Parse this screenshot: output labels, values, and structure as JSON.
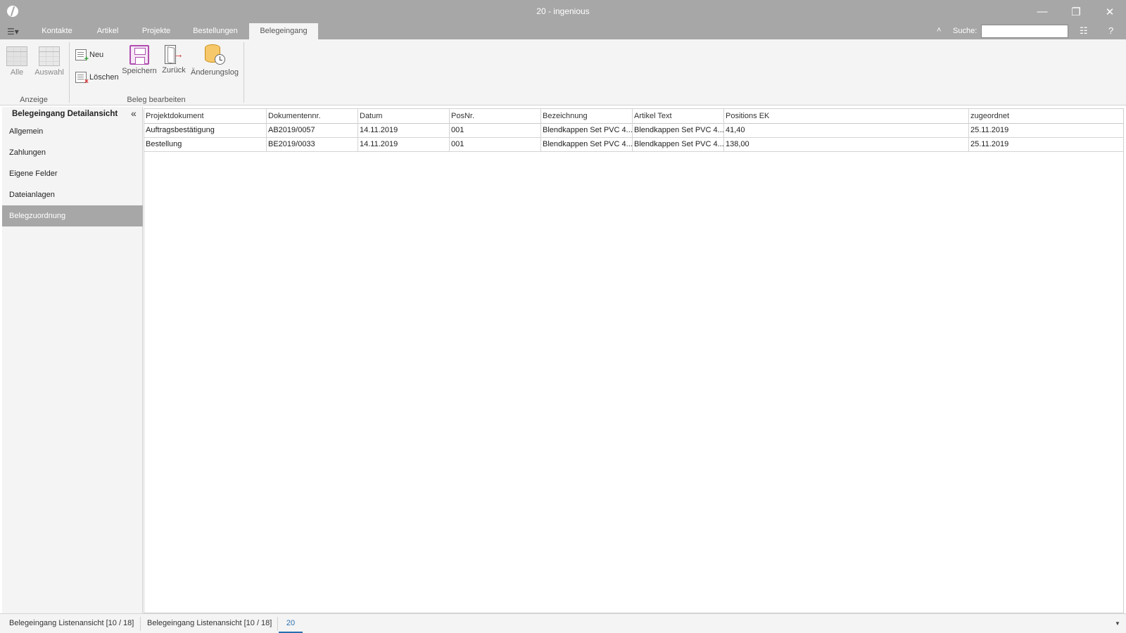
{
  "window": {
    "title": "20 - ingenious"
  },
  "menu": {
    "tabs": [
      {
        "label": "Kontakte"
      },
      {
        "label": "Artikel"
      },
      {
        "label": "Projekte"
      },
      {
        "label": "Bestellungen"
      },
      {
        "label": "Belegeingang"
      }
    ],
    "active_tab": "Belegeingang",
    "search_label": "Suche:",
    "search_value": ""
  },
  "ribbon": {
    "groups": {
      "anzeige": {
        "label": "Anzeige",
        "buttons": {
          "alle": "Alle",
          "auswahl": "Auswahl"
        }
      },
      "beleg_bearbeiten": {
        "label": "Beleg bearbeiten",
        "buttons": {
          "neu": "Neu",
          "loeschen": "Löschen",
          "speichern": "Speichern",
          "zurueck": "Zurück",
          "aenderungslog": "Änderungslog"
        }
      }
    }
  },
  "leftnav": {
    "title": "Belegeingang Detailansicht",
    "items": [
      {
        "label": "Allgemein"
      },
      {
        "label": "Zahlungen"
      },
      {
        "label": "Eigene Felder"
      },
      {
        "label": "Dateianlagen"
      },
      {
        "label": "Belegzuordnung"
      }
    ],
    "active_item": "Belegzuordnung"
  },
  "grid": {
    "columns": [
      "Projektdokument",
      "Dokumentennr.",
      "Datum",
      "PosNr.",
      "Bezeichnung",
      "Artikel Text",
      "Positions EK",
      "zugeordnet"
    ],
    "rows": [
      [
        "Auftragsbestätigung",
        "AB2019/0057",
        "14.11.2019",
        "001",
        "Blendkappen Set PVC 4...",
        "Blendkappen Set PVC 4...",
        "41,40",
        "25.11.2019"
      ],
      [
        "Bestellung",
        "BE2019/0033",
        "14.11.2019",
        "001",
        "Blendkappen Set PVC 4...",
        "Blendkappen Set PVC 4...",
        "138,00",
        "25.11.2019"
      ]
    ]
  },
  "bottom_tabs": [
    {
      "label": "Belegeingang Listenansicht [10 / 18]"
    },
    {
      "label": "Belegeingang Listenansicht [10 / 18]"
    },
    {
      "label": "20"
    }
  ],
  "colors": {
    "titlebar": "#a7a7a7",
    "ribbon": "#f4f4f4",
    "active_nav": "#a7a7a7",
    "active_bottom_tab": "#2a6fb0"
  }
}
